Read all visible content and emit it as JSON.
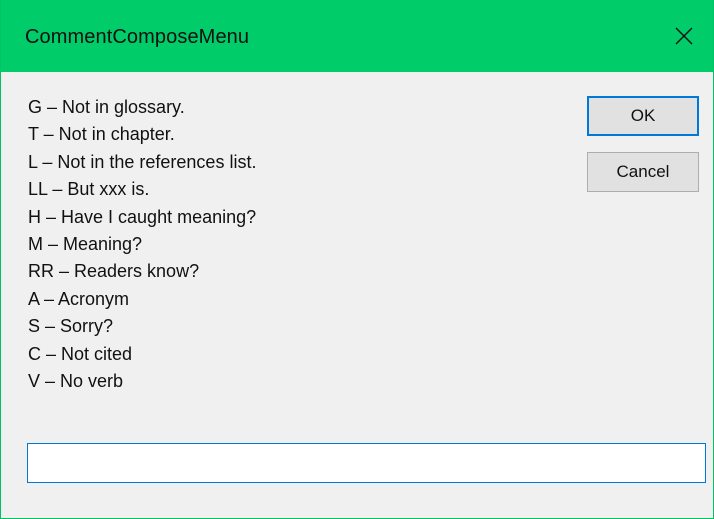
{
  "window": {
    "title": "CommentComposeMenu",
    "accent_color": "#00cc6a",
    "close_icon": "close-icon"
  },
  "shortcuts": [
    "G – Not in glossary.",
    "T – Not in chapter.",
    "L – Not in the references list.",
    "LL – But xxx is.",
    "H – Have I caught meaning?",
    "M – Meaning?",
    "RR – Readers know?",
    "A – Acronym",
    "S – Sorry?",
    "C – Not cited",
    "V – No verb"
  ],
  "buttons": {
    "ok_label": "OK",
    "cancel_label": "Cancel"
  },
  "input": {
    "value": "",
    "placeholder": ""
  }
}
